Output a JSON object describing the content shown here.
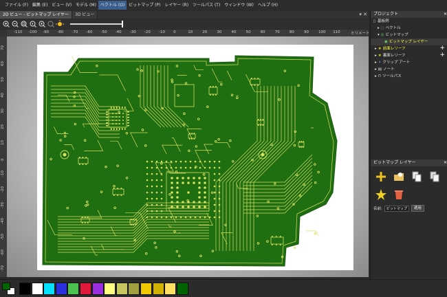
{
  "menu": [
    "ファイル (F)",
    "編集 (E)",
    "ビュー (V)",
    "モデル (M)",
    "ベクトル (O)",
    "ビットマップ (P)",
    "レイヤー (R)",
    "ツールパス (T)",
    "ウィンドウ (W)",
    "ヘルプ (H)"
  ],
  "tabs": [
    "2D ビュー - ビットマップ レイヤー",
    "3D ビュー"
  ],
  "ruler": {
    "h": [
      "-110",
      "-100",
      "-90",
      "-80",
      "-70",
      "-60",
      "-50",
      "-40",
      "-30",
      "-20",
      "-10",
      "0",
      "10",
      "20",
      "30",
      "40",
      "50",
      "60",
      "70",
      "80",
      "90",
      "100",
      "110"
    ],
    "unit": "ミリメートル",
    "v": [
      "70",
      "60",
      "50",
      "40",
      "30",
      "20",
      "10",
      "0",
      "-10",
      "-20",
      "-30",
      "-40",
      "-50",
      "-60",
      "-70"
    ]
  },
  "panel": {
    "title": "プロジェクト",
    "tree": [
      {
        "label": "基板例"
      },
      {
        "label": "ベクトル"
      },
      {
        "label": "ビットマップ"
      },
      {
        "label": "ビットマップ レイヤー"
      },
      {
        "label": "前面レリーフ"
      },
      {
        "label": "裏面レリーフ"
      },
      {
        "label": "クリップ アート"
      },
      {
        "label": "ノート"
      },
      {
        "label": "ツールパス"
      }
    ],
    "sub_title": "ビットマップ レイヤー",
    "name_label": "名前:",
    "name_value": "ビットマップ レイ",
    "apply_label": "適用"
  },
  "palette": {
    "fg": "#006400",
    "bg": "#ffffff",
    "colors": [
      "#000000",
      "#ffffff",
      "#00e0ff",
      "#2a30e0",
      "#4ec24e",
      "#e01a3c",
      "#9b2ee0",
      "#ffff80",
      "#c8c860",
      "#a0a040",
      "#f0c800",
      "#d0b000",
      "#ffe060",
      "#006400"
    ]
  },
  "pcb": {
    "board": "#1f6e12",
    "trace": "#d8e060"
  }
}
